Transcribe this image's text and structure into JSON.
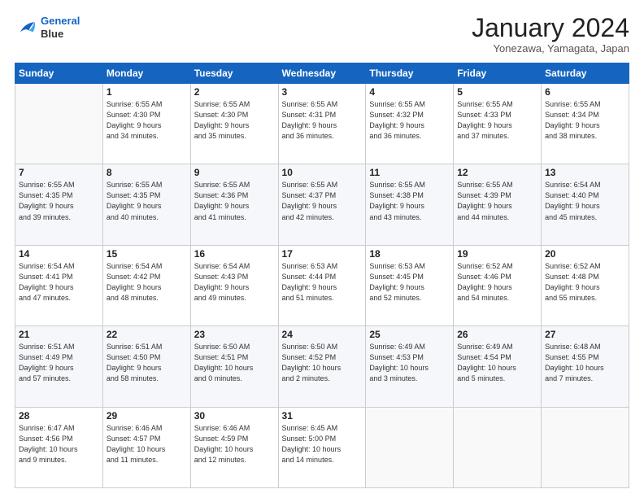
{
  "header": {
    "logo_line1": "General",
    "logo_line2": "Blue",
    "month_title": "January 2024",
    "location": "Yonezawa, Yamagata, Japan"
  },
  "days_of_week": [
    "Sunday",
    "Monday",
    "Tuesday",
    "Wednesday",
    "Thursday",
    "Friday",
    "Saturday"
  ],
  "weeks": [
    [
      {
        "day": "",
        "info": ""
      },
      {
        "day": "1",
        "info": "Sunrise: 6:55 AM\nSunset: 4:30 PM\nDaylight: 9 hours\nand 34 minutes."
      },
      {
        "day": "2",
        "info": "Sunrise: 6:55 AM\nSunset: 4:30 PM\nDaylight: 9 hours\nand 35 minutes."
      },
      {
        "day": "3",
        "info": "Sunrise: 6:55 AM\nSunset: 4:31 PM\nDaylight: 9 hours\nand 36 minutes."
      },
      {
        "day": "4",
        "info": "Sunrise: 6:55 AM\nSunset: 4:32 PM\nDaylight: 9 hours\nand 36 minutes."
      },
      {
        "day": "5",
        "info": "Sunrise: 6:55 AM\nSunset: 4:33 PM\nDaylight: 9 hours\nand 37 minutes."
      },
      {
        "day": "6",
        "info": "Sunrise: 6:55 AM\nSunset: 4:34 PM\nDaylight: 9 hours\nand 38 minutes."
      }
    ],
    [
      {
        "day": "7",
        "info": "Sunrise: 6:55 AM\nSunset: 4:35 PM\nDaylight: 9 hours\nand 39 minutes."
      },
      {
        "day": "8",
        "info": "Sunrise: 6:55 AM\nSunset: 4:35 PM\nDaylight: 9 hours\nand 40 minutes."
      },
      {
        "day": "9",
        "info": "Sunrise: 6:55 AM\nSunset: 4:36 PM\nDaylight: 9 hours\nand 41 minutes."
      },
      {
        "day": "10",
        "info": "Sunrise: 6:55 AM\nSunset: 4:37 PM\nDaylight: 9 hours\nand 42 minutes."
      },
      {
        "day": "11",
        "info": "Sunrise: 6:55 AM\nSunset: 4:38 PM\nDaylight: 9 hours\nand 43 minutes."
      },
      {
        "day": "12",
        "info": "Sunrise: 6:55 AM\nSunset: 4:39 PM\nDaylight: 9 hours\nand 44 minutes."
      },
      {
        "day": "13",
        "info": "Sunrise: 6:54 AM\nSunset: 4:40 PM\nDaylight: 9 hours\nand 45 minutes."
      }
    ],
    [
      {
        "day": "14",
        "info": "Sunrise: 6:54 AM\nSunset: 4:41 PM\nDaylight: 9 hours\nand 47 minutes."
      },
      {
        "day": "15",
        "info": "Sunrise: 6:54 AM\nSunset: 4:42 PM\nDaylight: 9 hours\nand 48 minutes."
      },
      {
        "day": "16",
        "info": "Sunrise: 6:54 AM\nSunset: 4:43 PM\nDaylight: 9 hours\nand 49 minutes."
      },
      {
        "day": "17",
        "info": "Sunrise: 6:53 AM\nSunset: 4:44 PM\nDaylight: 9 hours\nand 51 minutes."
      },
      {
        "day": "18",
        "info": "Sunrise: 6:53 AM\nSunset: 4:45 PM\nDaylight: 9 hours\nand 52 minutes."
      },
      {
        "day": "19",
        "info": "Sunrise: 6:52 AM\nSunset: 4:46 PM\nDaylight: 9 hours\nand 54 minutes."
      },
      {
        "day": "20",
        "info": "Sunrise: 6:52 AM\nSunset: 4:48 PM\nDaylight: 9 hours\nand 55 minutes."
      }
    ],
    [
      {
        "day": "21",
        "info": "Sunrise: 6:51 AM\nSunset: 4:49 PM\nDaylight: 9 hours\nand 57 minutes."
      },
      {
        "day": "22",
        "info": "Sunrise: 6:51 AM\nSunset: 4:50 PM\nDaylight: 9 hours\nand 58 minutes."
      },
      {
        "day": "23",
        "info": "Sunrise: 6:50 AM\nSunset: 4:51 PM\nDaylight: 10 hours\nand 0 minutes."
      },
      {
        "day": "24",
        "info": "Sunrise: 6:50 AM\nSunset: 4:52 PM\nDaylight: 10 hours\nand 2 minutes."
      },
      {
        "day": "25",
        "info": "Sunrise: 6:49 AM\nSunset: 4:53 PM\nDaylight: 10 hours\nand 3 minutes."
      },
      {
        "day": "26",
        "info": "Sunrise: 6:49 AM\nSunset: 4:54 PM\nDaylight: 10 hours\nand 5 minutes."
      },
      {
        "day": "27",
        "info": "Sunrise: 6:48 AM\nSunset: 4:55 PM\nDaylight: 10 hours\nand 7 minutes."
      }
    ],
    [
      {
        "day": "28",
        "info": "Sunrise: 6:47 AM\nSunset: 4:56 PM\nDaylight: 10 hours\nand 9 minutes."
      },
      {
        "day": "29",
        "info": "Sunrise: 6:46 AM\nSunset: 4:57 PM\nDaylight: 10 hours\nand 11 minutes."
      },
      {
        "day": "30",
        "info": "Sunrise: 6:46 AM\nSunset: 4:59 PM\nDaylight: 10 hours\nand 12 minutes."
      },
      {
        "day": "31",
        "info": "Sunrise: 6:45 AM\nSunset: 5:00 PM\nDaylight: 10 hours\nand 14 minutes."
      },
      {
        "day": "",
        "info": ""
      },
      {
        "day": "",
        "info": ""
      },
      {
        "day": "",
        "info": ""
      }
    ]
  ]
}
